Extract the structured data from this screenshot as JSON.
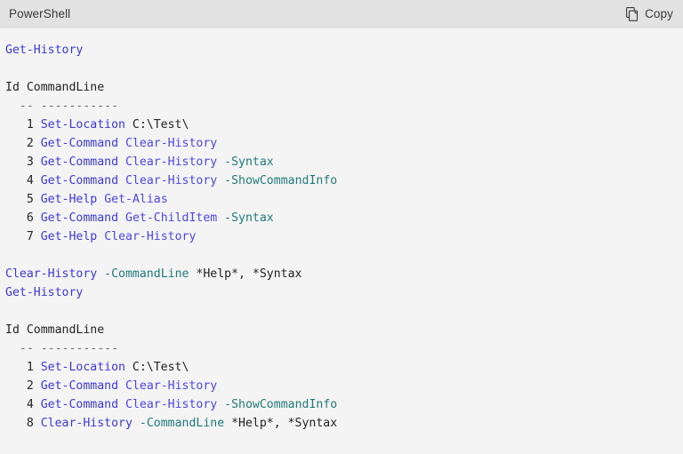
{
  "header": {
    "language_label": "PowerShell",
    "copy_label": "Copy",
    "copy_icon": "copy-icon",
    "background_color": "#e2e2e2"
  },
  "theme": {
    "body_background": "#f4f4f4",
    "cmdlet_color": "#3b39da",
    "argument_color": "#4b48e6",
    "parameter_color": "#217a7a",
    "plain_color": "#232323",
    "dash_color": "#6d6d6d"
  },
  "code": {
    "lines": [
      {
        "id": "l1",
        "tokens": [
          {
            "t": "Get-History",
            "c": "cmdlet"
          }
        ]
      },
      {
        "id": "l2",
        "tokens": []
      },
      {
        "id": "l3",
        "tokens": [
          {
            "t": "Id CommandLine",
            "c": "plain"
          }
        ]
      },
      {
        "id": "l4",
        "tokens": [
          {
            "t": "  -- -----------",
            "c": "dash"
          }
        ]
      },
      {
        "id": "l5",
        "tokens": [
          {
            "t": "   1 ",
            "c": "plain"
          },
          {
            "t": "Set-Location",
            "c": "cmdlet"
          },
          {
            "t": " C:\\Test\\",
            "c": "plain"
          }
        ]
      },
      {
        "id": "l6",
        "tokens": [
          {
            "t": "   2 ",
            "c": "plain"
          },
          {
            "t": "Get-Command",
            "c": "cmdlet"
          },
          {
            "t": " ",
            "c": "plain"
          },
          {
            "t": "Clear-History",
            "c": "arg"
          }
        ]
      },
      {
        "id": "l7",
        "tokens": [
          {
            "t": "   3 ",
            "c": "plain"
          },
          {
            "t": "Get-Command",
            "c": "cmdlet"
          },
          {
            "t": " ",
            "c": "plain"
          },
          {
            "t": "Clear-History",
            "c": "arg"
          },
          {
            "t": " ",
            "c": "plain"
          },
          {
            "t": "-Syntax",
            "c": "param"
          }
        ]
      },
      {
        "id": "l8",
        "tokens": [
          {
            "t": "   4 ",
            "c": "plain"
          },
          {
            "t": "Get-Command",
            "c": "cmdlet"
          },
          {
            "t": " ",
            "c": "plain"
          },
          {
            "t": "Clear-History",
            "c": "arg"
          },
          {
            "t": " ",
            "c": "plain"
          },
          {
            "t": "-ShowCommandInfo",
            "c": "param"
          }
        ]
      },
      {
        "id": "l9",
        "tokens": [
          {
            "t": "   5 ",
            "c": "plain"
          },
          {
            "t": "Get-Help",
            "c": "cmdlet"
          },
          {
            "t": " ",
            "c": "plain"
          },
          {
            "t": "Get-Alias",
            "c": "arg"
          }
        ]
      },
      {
        "id": "l10",
        "tokens": [
          {
            "t": "   6 ",
            "c": "plain"
          },
          {
            "t": "Get-Command",
            "c": "cmdlet"
          },
          {
            "t": " ",
            "c": "plain"
          },
          {
            "t": "Get-ChildItem",
            "c": "arg"
          },
          {
            "t": " ",
            "c": "plain"
          },
          {
            "t": "-Syntax",
            "c": "param"
          }
        ]
      },
      {
        "id": "l11",
        "tokens": [
          {
            "t": "   7 ",
            "c": "plain"
          },
          {
            "t": "Get-Help",
            "c": "cmdlet"
          },
          {
            "t": " ",
            "c": "plain"
          },
          {
            "t": "Clear-History",
            "c": "arg"
          }
        ]
      },
      {
        "id": "l12",
        "tokens": []
      },
      {
        "id": "l13",
        "tokens": [
          {
            "t": "Clear-History",
            "c": "cmdlet"
          },
          {
            "t": " ",
            "c": "plain"
          },
          {
            "t": "-CommandLine",
            "c": "param"
          },
          {
            "t": " *Help*, *Syntax",
            "c": "plain"
          }
        ]
      },
      {
        "id": "l14",
        "tokens": [
          {
            "t": "Get-History",
            "c": "cmdlet"
          }
        ]
      },
      {
        "id": "l15",
        "tokens": []
      },
      {
        "id": "l16",
        "tokens": [
          {
            "t": "Id CommandLine",
            "c": "plain"
          }
        ]
      },
      {
        "id": "l17",
        "tokens": [
          {
            "t": "  -- -----------",
            "c": "dash"
          }
        ]
      },
      {
        "id": "l18",
        "tokens": [
          {
            "t": "   1 ",
            "c": "plain"
          },
          {
            "t": "Set-Location",
            "c": "cmdlet"
          },
          {
            "t": " C:\\Test\\",
            "c": "plain"
          }
        ]
      },
      {
        "id": "l19",
        "tokens": [
          {
            "t": "   2 ",
            "c": "plain"
          },
          {
            "t": "Get-Command",
            "c": "cmdlet"
          },
          {
            "t": " ",
            "c": "plain"
          },
          {
            "t": "Clear-History",
            "c": "arg"
          }
        ]
      },
      {
        "id": "l20",
        "tokens": [
          {
            "t": "   4 ",
            "c": "plain"
          },
          {
            "t": "Get-Command",
            "c": "cmdlet"
          },
          {
            "t": " ",
            "c": "plain"
          },
          {
            "t": "Clear-History",
            "c": "arg"
          },
          {
            "t": " ",
            "c": "plain"
          },
          {
            "t": "-ShowCommandInfo",
            "c": "param"
          }
        ]
      },
      {
        "id": "l21",
        "tokens": [
          {
            "t": "   8 ",
            "c": "plain"
          },
          {
            "t": "Clear-History",
            "c": "cmdlet"
          },
          {
            "t": " ",
            "c": "plain"
          },
          {
            "t": "-CommandLine",
            "c": "param"
          },
          {
            "t": " *Help*, *Syntax",
            "c": "plain"
          }
        ]
      }
    ]
  }
}
